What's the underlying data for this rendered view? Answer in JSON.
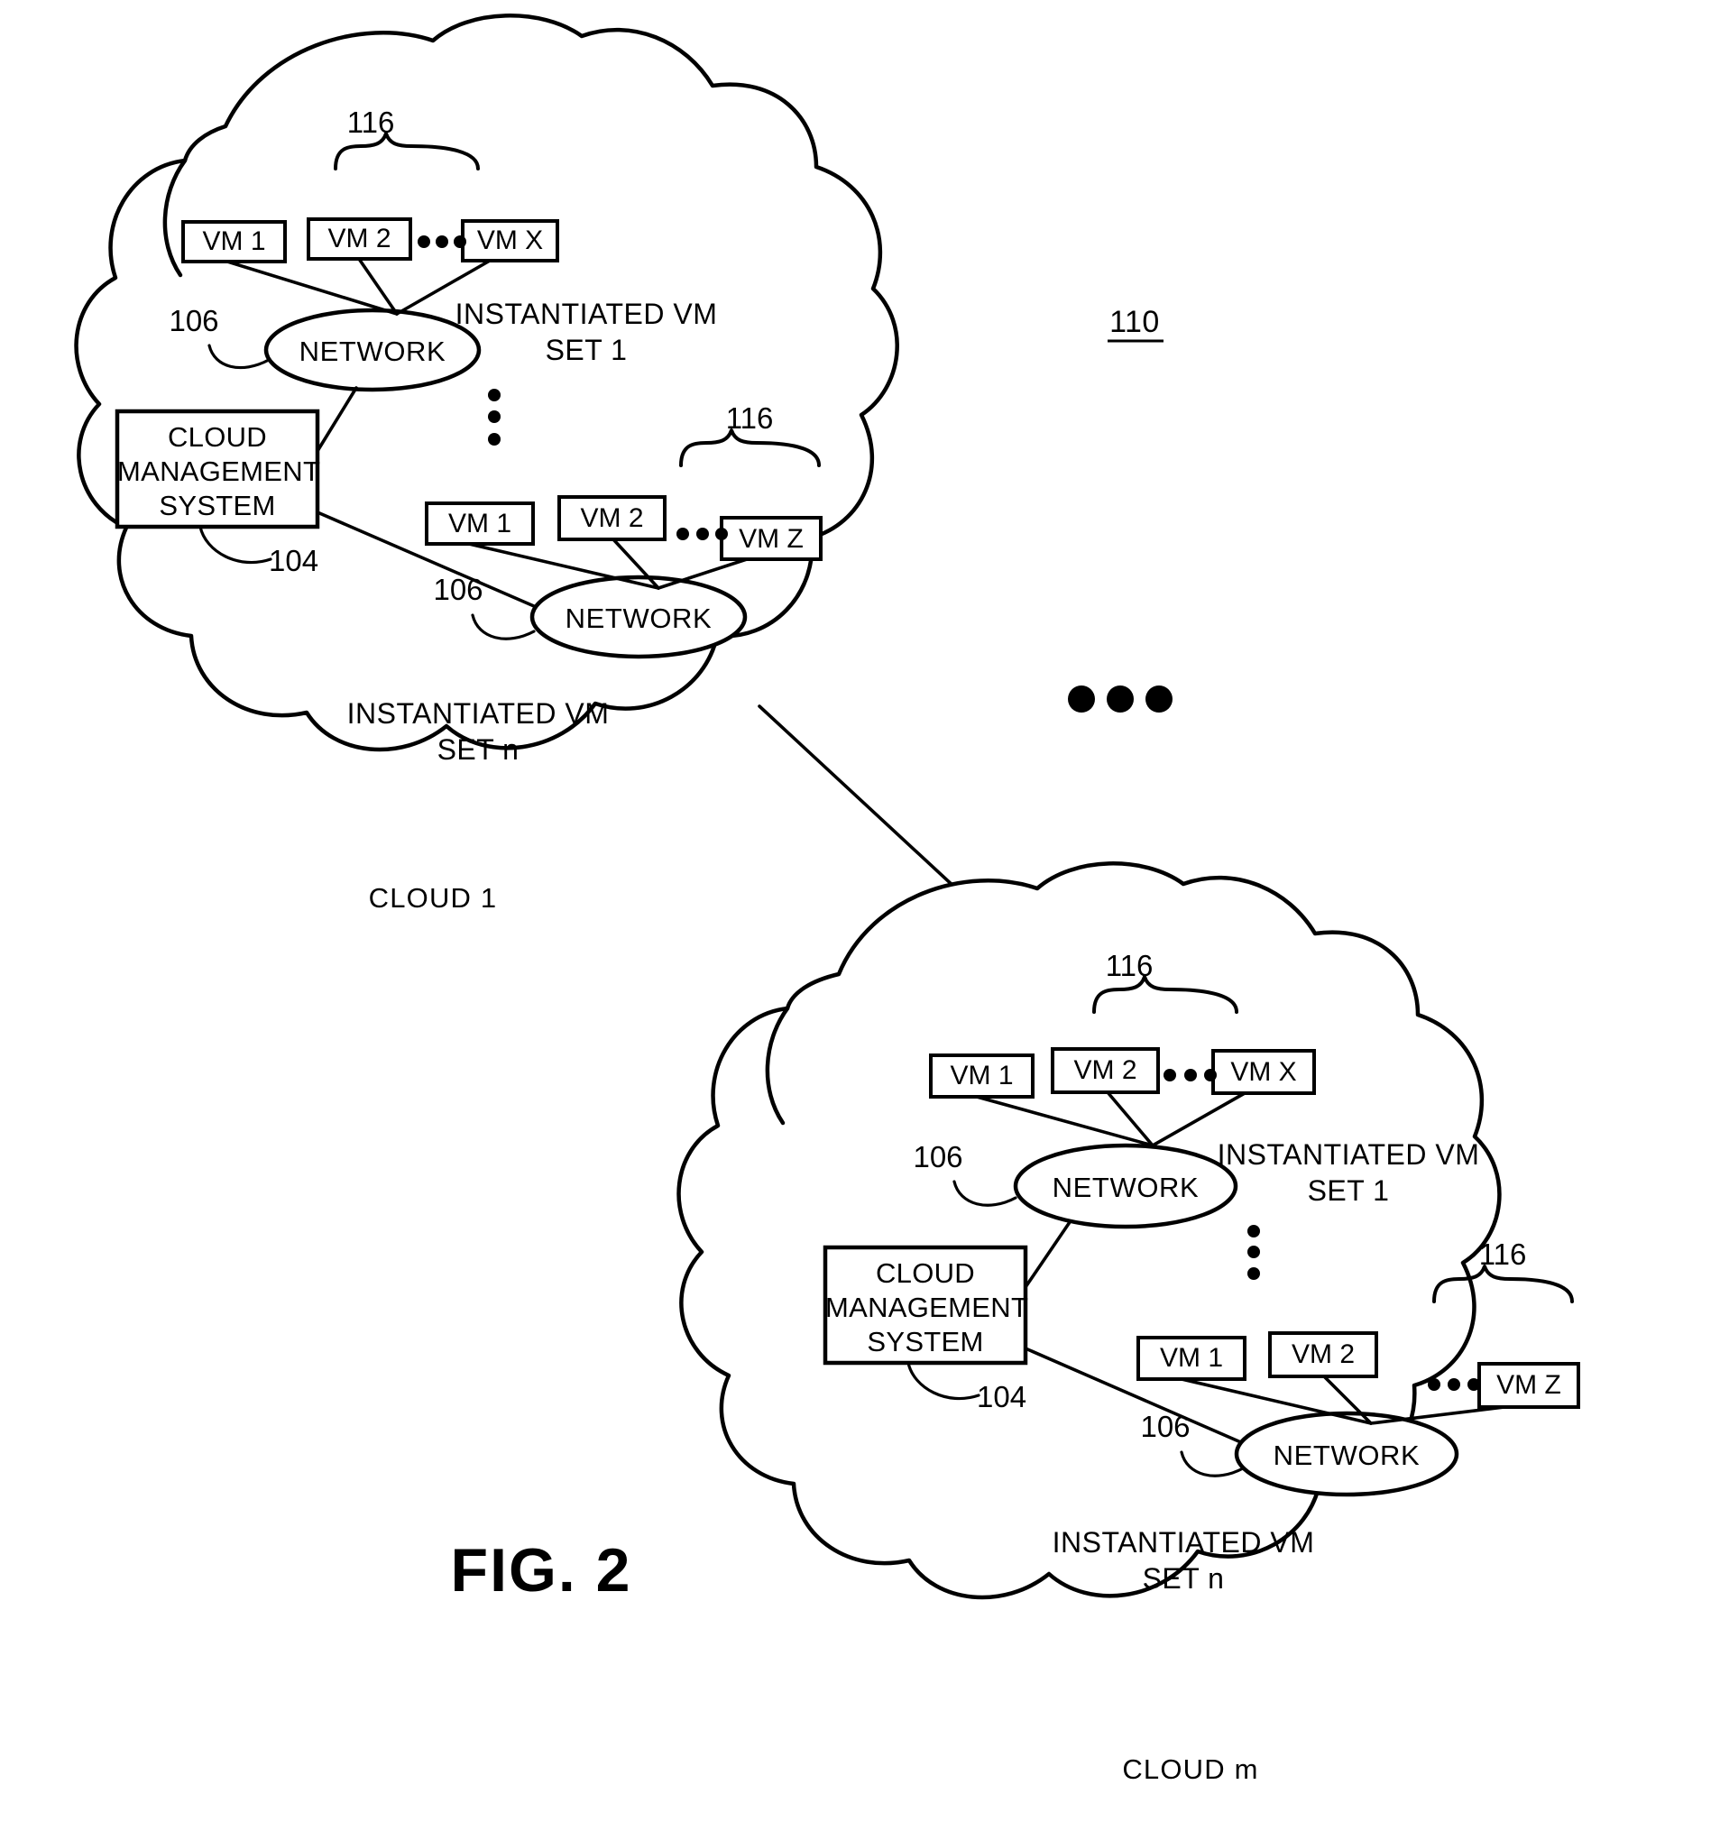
{
  "figure": {
    "caption": "FIG. 2",
    "system_ref": "110"
  },
  "clouds": [
    {
      "id": "cloud-1",
      "label": "CLOUD 1",
      "management_system": {
        "lines": [
          "CLOUD",
          "MANAGEMENT",
          "SYSTEM"
        ],
        "ref": "104"
      },
      "vm_sets": [
        {
          "name": "INSTANTIATED VM",
          "name_line2": "SET 1",
          "brace_ref": "116",
          "network_label": "NETWORK",
          "network_ref": "106",
          "vms": [
            "VM 1",
            "VM 2",
            "VM X"
          ],
          "ellipsis": "•••"
        },
        {
          "name": "INSTANTIATED VM",
          "name_line2": "SET n",
          "brace_ref": "116",
          "network_label": "NETWORK",
          "network_ref": "106",
          "vms": [
            "VM 1",
            "VM 2",
            "VM Z"
          ],
          "ellipsis": "•••"
        }
      ],
      "vertical_ellipsis": "⋮"
    },
    {
      "id": "cloud-m",
      "label": "CLOUD m",
      "management_system": {
        "lines": [
          "CLOUD",
          "MANAGEMENT",
          "SYSTEM"
        ],
        "ref": "104"
      },
      "vm_sets": [
        {
          "name": "INSTANTIATED VM",
          "name_line2": "SET 1",
          "brace_ref": "116",
          "network_label": "NETWORK",
          "network_ref": "106",
          "vms": [
            "VM 1",
            "VM 2",
            "VM X"
          ],
          "ellipsis": "•••"
        },
        {
          "name": "INSTANTIATED VM",
          "name_line2": "SET n",
          "brace_ref": "116",
          "network_label": "NETWORK",
          "network_ref": "106",
          "vms": [
            "VM 1",
            "VM 2",
            "VM Z"
          ],
          "ellipsis": "•••"
        }
      ],
      "vertical_ellipsis": "⋮"
    }
  ],
  "between_clouds_ellipsis": "• • •",
  "colors": {
    "ink": "#000000",
    "paper": "#ffffff"
  }
}
